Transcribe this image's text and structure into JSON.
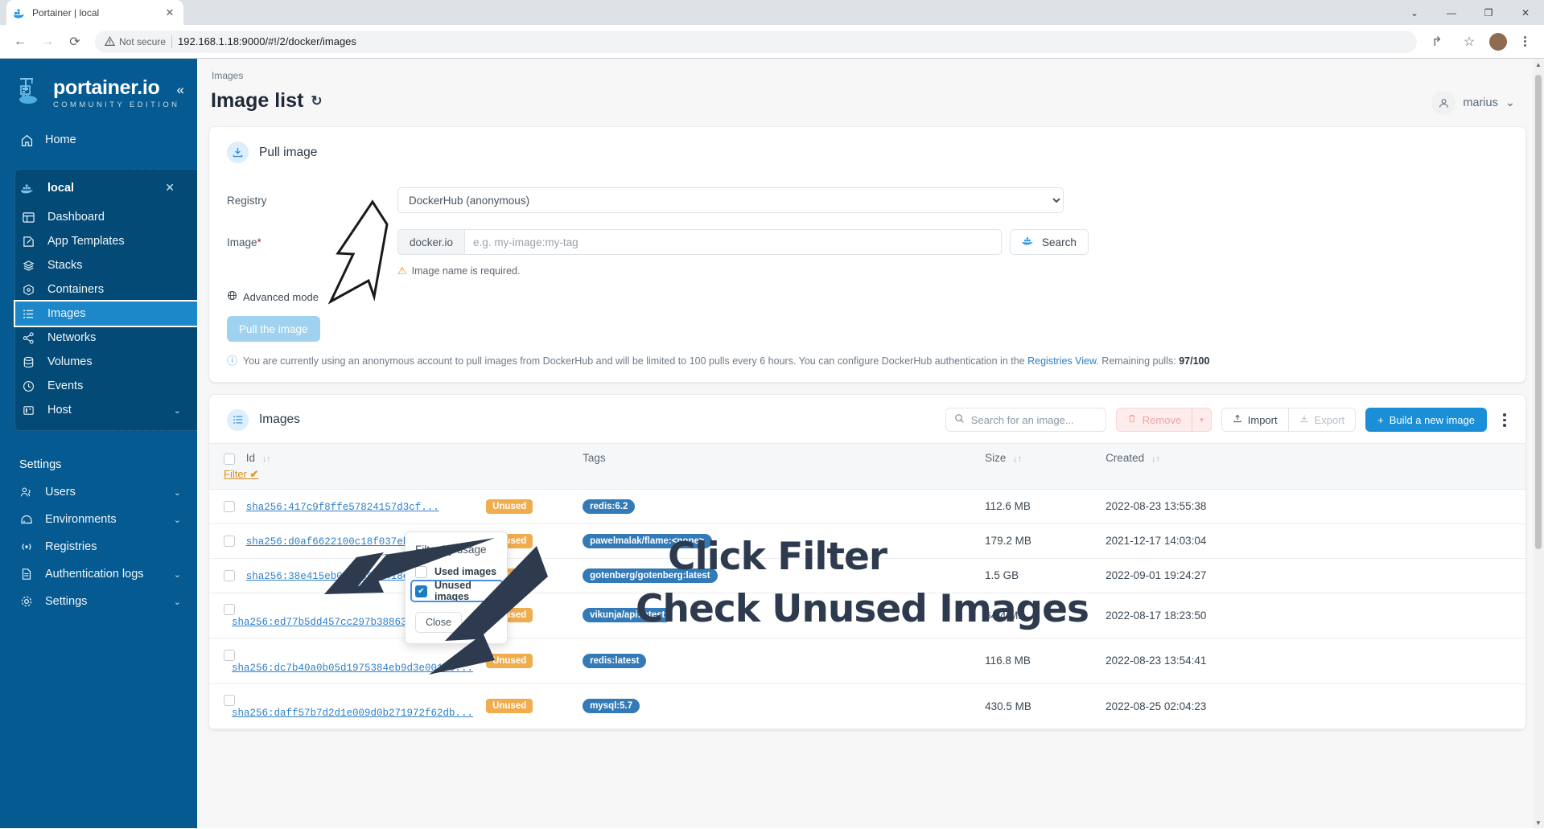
{
  "browser": {
    "tab_title": "Portainer | local",
    "tab_close": "✕",
    "favicon": "portainer-whale-icon",
    "back": "←",
    "forward": "→",
    "reload": "⟳",
    "security_label": "Not secure",
    "url": "192.168.1.18:9000/#!/2/docker/images",
    "share_icon": "↱",
    "bookmark_icon": "☆",
    "profile_initial": "",
    "window_minimize": "—",
    "window_maximize": "❐",
    "window_close": "✕",
    "window_restore": "⌄"
  },
  "sidebar": {
    "brand_name": "portainer.io",
    "brand_sub": "COMMUNITY EDITION",
    "collapse_icon": "«",
    "home_label": "Home",
    "environment": {
      "name": "local",
      "close_icon": "✕",
      "items": [
        {
          "label": "Dashboard",
          "icon": "dashboard-icon"
        },
        {
          "label": "App Templates",
          "icon": "templates-icon"
        },
        {
          "label": "Stacks",
          "icon": "stacks-icon"
        },
        {
          "label": "Containers",
          "icon": "containers-icon"
        },
        {
          "label": "Images",
          "icon": "images-icon",
          "active": true
        },
        {
          "label": "Networks",
          "icon": "networks-icon"
        },
        {
          "label": "Volumes",
          "icon": "volumes-icon"
        },
        {
          "label": "Events",
          "icon": "events-icon"
        },
        {
          "label": "Host",
          "icon": "host-icon",
          "chevron": "⌄"
        }
      ]
    },
    "settings_title": "Settings",
    "settings_items": [
      {
        "label": "Users",
        "icon": "users-icon",
        "chevron": "⌄"
      },
      {
        "label": "Environments",
        "icon": "environments-icon",
        "chevron": "⌄"
      },
      {
        "label": "Registries",
        "icon": "registries-icon",
        "chevron": ""
      },
      {
        "label": "Authentication logs",
        "icon": "auth-logs-icon",
        "chevron": "⌄"
      },
      {
        "label": "Settings",
        "icon": "settings-gear-icon",
        "chevron": "⌄"
      }
    ]
  },
  "header": {
    "breadcrumb": "Images",
    "title": "Image list",
    "refresh_icon": "↻",
    "user_name": "marius",
    "user_chevron": "⌄"
  },
  "pull_card": {
    "icon": "download-icon",
    "title": "Pull image",
    "registry_label": "Registry",
    "registry_value": "DockerHub (anonymous)",
    "registry_options": [
      "DockerHub (anonymous)"
    ],
    "image_label": "Image",
    "image_required_mark": "*",
    "image_addon": "docker.io",
    "image_placeholder": "e.g. my-image:my-tag",
    "image_value": "",
    "search_label": "Search",
    "search_icon": "docker-whale-icon",
    "error_text": "Image name is required.",
    "error_icon": "warning-triangle-icon",
    "advanced_label": "Advanced mode",
    "advanced_icon": "globe-icon",
    "pull_button": "Pull the image",
    "note_icon": "info-circle-icon",
    "note_part1": "You are currently using an anonymous account to pull images from DockerHub and will be limited to 100 pulls every 6 hours. You can configure DockerHub authentication in the ",
    "note_link": "Registries View",
    "note_part2": ". Remaining pulls: ",
    "note_count": "97/100"
  },
  "images_card": {
    "icon": "list-icon",
    "title": "Images",
    "search_placeholder": "Search for an image...",
    "search_value": "",
    "remove_label": "Remove",
    "remove_caret": "▾",
    "import_label": "Import",
    "export_label": "Export",
    "build_label": "Build a new image",
    "build_plus": "+",
    "kebab": "more-options-icon",
    "columns": {
      "id": "Id",
      "filter_link": "Filter",
      "filter_check": "✔",
      "tags": "Tags",
      "size": "Size",
      "created": "Created",
      "sort_icon": "↓↑"
    },
    "rows": [
      {
        "id": "sha256:417c9f8ffe57824157d3cf...",
        "status": "Unused",
        "tag": "redis:6.2",
        "size": "112.6 MB",
        "created": "2022-08-23 13:55:38"
      },
      {
        "id": "sha256:d0af6622100c18f037eb69a...",
        "status": "Unused",
        "tag": "pawelmalak/flame:<none>",
        "size": "179.2 MB",
        "created": "2021-12-17 14:03:04"
      },
      {
        "id": "sha256:38e415eb0017b9af418efcf...",
        "status": "Unused",
        "tag": "gotenberg/gotenberg:latest",
        "size": "1.5 GB",
        "created": "2022-09-01 19:24:27"
      },
      {
        "id": "sha256:ed77b5dd457cc297b3886388e53e9d...",
        "status": "Unused",
        "tag": "vikunja/api:latest",
        "size": "64.4 MB",
        "created": "2022-08-17 18:23:50"
      },
      {
        "id": "sha256:dc7b40a0b05d1975384eb9d3e001fe...",
        "status": "Unused",
        "tag": "redis:latest",
        "size": "116.8 MB",
        "created": "2022-08-23 13:54:41"
      },
      {
        "id": "sha256:daff57b7d2d1e009d0b271972f62db...",
        "status": "Unused",
        "tag": "mysql:5.7",
        "size": "430.5 MB",
        "created": "2022-08-25 02:04:23"
      }
    ]
  },
  "filter_popover": {
    "title": "Filter by usage",
    "used_label": "Used images",
    "unused_label": "Unused images",
    "unused_checked": true,
    "check_glyph": "✔",
    "close_label": "Close"
  },
  "annotations": {
    "line1": "Click Filter",
    "line2": "Check Unused Images"
  },
  "colors": {
    "sidebar_bg": "#055b91",
    "accent": "#1a8fd8",
    "badge_unused": "#f0ad4e",
    "tag_badge": "#337ab7",
    "annotation": "#2e3b4e"
  }
}
